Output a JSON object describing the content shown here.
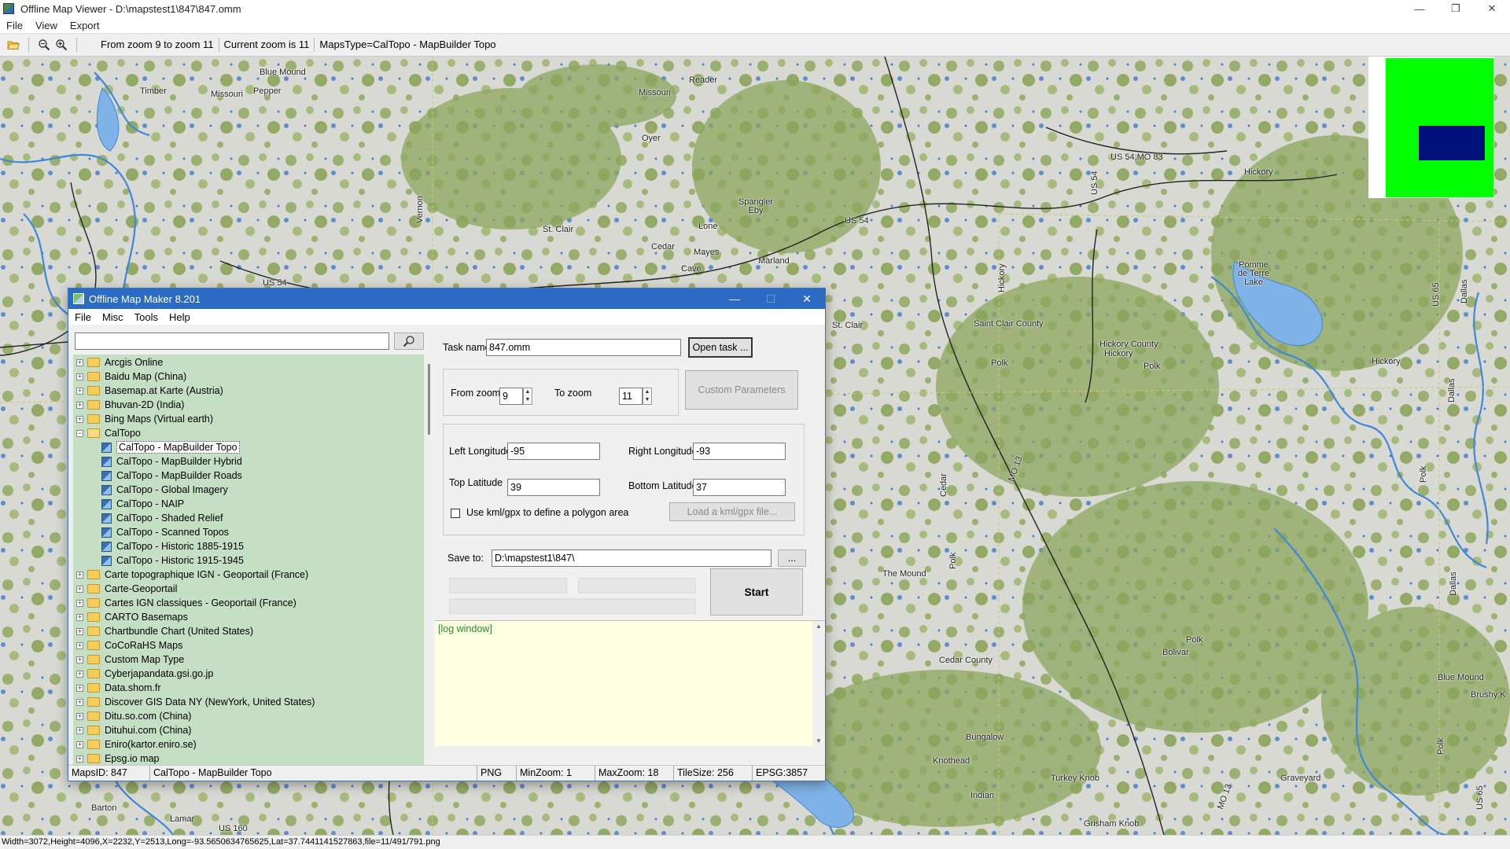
{
  "window": {
    "title": "Offline Map Viewer - D:\\mapstest1\\847\\847.omm",
    "controls": [
      "—",
      "❐",
      "✕"
    ]
  },
  "menu": [
    "File",
    "View",
    "Export"
  ],
  "toolbar": {
    "zoom_range": "From zoom 9 to zoom 11",
    "current_zoom": "Current zoom is 11",
    "maps_type": "MapsType=CalTopo - MapBuilder Topo",
    "icons": [
      "open-folder-icon",
      "zoom-out-icon",
      "zoom-in-icon"
    ]
  },
  "map": {
    "labels": [
      "Blue Mound",
      "Timber",
      "Missouri",
      "Pepper",
      "Reader",
      "Missouri",
      "Oyer",
      "US 54;MO 83",
      "Hickory",
      "Spangler Eby",
      "Lone",
      "St. Clair",
      "US 54",
      "Cedar",
      "Mayes",
      "Marland",
      "Cave",
      "Vernon",
      "US 54",
      "US 54",
      "Hickory",
      "Saint Clair County",
      "Hickory County",
      "Hickory",
      "Polk",
      "Polk",
      "Pomme de Terre Lake",
      "Hickory",
      "Dallas",
      "US 65",
      "St. Clair",
      "MO 13",
      "Cedar",
      "Polk",
      "The Mound",
      "Polk",
      "Bolivar",
      "Cedar County",
      "Blue Mound",
      "Brushy K",
      "Bungalow",
      "Knothead",
      "Turkey Knob",
      "Graveyard",
      "Indian",
      "Grisham Knob",
      "MO 13",
      "US 65",
      "Dallas",
      "Polk",
      "Barton",
      "Lamar",
      "US 160",
      "Polk",
      "Dallas"
    ],
    "overview": {
      "bg": "#00ff00",
      "viewport": "#00107a"
    }
  },
  "status": "Width=3072,Height=4096,X=2232,Y=2513,Long=-93.5650634765625,Lat=37.7441141527863,file=11/491/791.png",
  "dialog": {
    "title": "Offline Map Maker 8.201",
    "controls": [
      "—",
      "☐",
      "✕"
    ],
    "menu": [
      "File",
      "Misc",
      "Tools",
      "Help"
    ],
    "search": {
      "value": "",
      "icon": "search-icon"
    },
    "tree": [
      {
        "label": "Arcgis Online",
        "level": 0,
        "type": "folder",
        "exp": "+"
      },
      {
        "label": "Baidu Map (China)",
        "level": 0,
        "type": "folder",
        "exp": "+"
      },
      {
        "label": "Basemap.at Karte (Austria)",
        "level": 0,
        "type": "folder",
        "exp": "+"
      },
      {
        "label": "Bhuvan-2D (India)",
        "level": 0,
        "type": "folder",
        "exp": "+"
      },
      {
        "label": "Bing Maps (Virtual earth)",
        "level": 0,
        "type": "folder",
        "exp": "+"
      },
      {
        "label": "CalTopo",
        "level": 0,
        "type": "folder-open",
        "exp": "−"
      },
      {
        "label": "CalTopo - MapBuilder Topo",
        "level": 1,
        "type": "map",
        "selected": true
      },
      {
        "label": "CalTopo - MapBuilder Hybrid",
        "level": 1,
        "type": "map"
      },
      {
        "label": "CalTopo - MapBuilder Roads",
        "level": 1,
        "type": "map"
      },
      {
        "label": "CalTopo - Global Imagery",
        "level": 1,
        "type": "map"
      },
      {
        "label": "CalTopo - NAIP",
        "level": 1,
        "type": "map"
      },
      {
        "label": "CalTopo - Shaded Relief",
        "level": 1,
        "type": "map"
      },
      {
        "label": "CalTopo - Scanned Topos",
        "level": 1,
        "type": "map"
      },
      {
        "label": "CalTopo - Historic 1885-1915",
        "level": 1,
        "type": "map"
      },
      {
        "label": "CalTopo - Historic 1915-1945",
        "level": 1,
        "type": "map"
      },
      {
        "label": "Carte topographique IGN - Geoportail (France)",
        "level": 0,
        "type": "folder",
        "exp": "+"
      },
      {
        "label": "Carte-Geoportail",
        "level": 0,
        "type": "folder",
        "exp": "+"
      },
      {
        "label": "Cartes IGN classiques - Geoportail (France)",
        "level": 0,
        "type": "folder",
        "exp": "+"
      },
      {
        "label": "CARTO Basemaps",
        "level": 0,
        "type": "folder",
        "exp": "+"
      },
      {
        "label": "Chartbundle Chart (United States)",
        "level": 0,
        "type": "folder",
        "exp": "+"
      },
      {
        "label": "CoCoRaHS Maps",
        "level": 0,
        "type": "folder",
        "exp": "+"
      },
      {
        "label": "Custom Map Type",
        "level": 0,
        "type": "folder",
        "exp": "+"
      },
      {
        "label": "Cyberjapandata.gsi.go.jp",
        "level": 0,
        "type": "folder",
        "exp": "+"
      },
      {
        "label": "Data.shom.fr",
        "level": 0,
        "type": "folder",
        "exp": "+"
      },
      {
        "label": "Discover GIS Data NY (NewYork, United States)",
        "level": 0,
        "type": "folder",
        "exp": "+"
      },
      {
        "label": "Ditu.so.com (China)",
        "level": 0,
        "type": "folder",
        "exp": "+"
      },
      {
        "label": "Dituhui.com (China)",
        "level": 0,
        "type": "folder",
        "exp": "+"
      },
      {
        "label": "Eniro(kartor.eniro.se)",
        "level": 0,
        "type": "folder",
        "exp": "+"
      },
      {
        "label": "Epsg.io map",
        "level": 0,
        "type": "folder",
        "exp": "+"
      }
    ],
    "task": {
      "task_name_label": "Task name",
      "task_name_value": "847.omm",
      "open_task_label": "Open task ...",
      "from_zoom_label": "From zoom",
      "from_zoom_value": "9",
      "to_zoom_label": "To zoom",
      "to_zoom_value": "11",
      "custom_params_label": "Custom Parameters",
      "left_lon_label": "Left Longitude",
      "left_lon_value": "-95",
      "right_lon_label": "Right Longitude",
      "right_lon_value": "-93",
      "top_lat_label": "Top Latitude",
      "top_lat_value": "39",
      "bottom_lat_label": "Bottom Latitude",
      "bottom_lat_value": "37",
      "kml_check_label": "Use kml/gpx to define a polygon area",
      "load_kml_label": "Load a kml/gpx file...",
      "save_to_label": "Save to:",
      "save_to_value": "D:\\mapstest1\\847\\",
      "browse_label": "...",
      "start_label": "Start",
      "log_text": "[log window]"
    },
    "status": {
      "maps_id": "MapsID: 847",
      "maps_name": "CalTopo - MapBuilder Topo",
      "format": "PNG",
      "min_zoom": "MinZoom: 1",
      "max_zoom": "MaxZoom: 18",
      "tile_size": "TileSize: 256",
      "epsg": "EPSG:3857"
    }
  }
}
